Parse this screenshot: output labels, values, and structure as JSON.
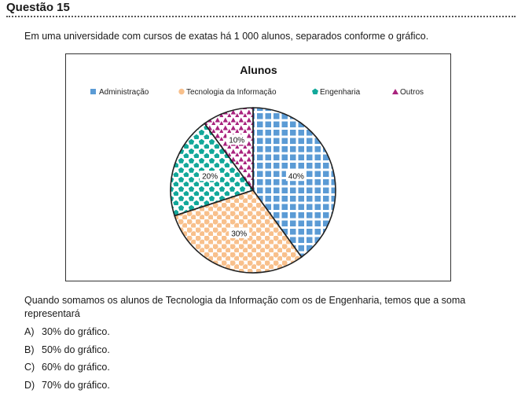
{
  "header": {
    "title": "Questão 15"
  },
  "intro": "Em uma universidade com cursos de exatas há 1 000 alunos, separados conforme o gráfico.",
  "question": "Quando somamos os alunos de Tecnologia da Informação com os de Engenharia, temos que a soma representará",
  "options": [
    {
      "letter": "A)",
      "text": "30% do gráfico."
    },
    {
      "letter": "B)",
      "text": "50% do gráfico."
    },
    {
      "letter": "C)",
      "text": "60% do gráfico."
    },
    {
      "letter": "D)",
      "text": "70% do gráfico."
    }
  ],
  "chart_data": {
    "type": "pie",
    "title": "Alunos",
    "legend_position": "top",
    "categories": [
      "Administração",
      "Tecnologia da Informação",
      "Engenharia",
      "Outros"
    ],
    "values": [
      40,
      30,
      20,
      10
    ],
    "labels": [
      "40%",
      "30%",
      "20%",
      "10%"
    ],
    "markers": [
      "square",
      "circle",
      "pentagon",
      "triangle"
    ],
    "colors": [
      "#5b9bd5",
      "#f8c08c",
      "#12a89a",
      "#a9237e"
    ]
  }
}
